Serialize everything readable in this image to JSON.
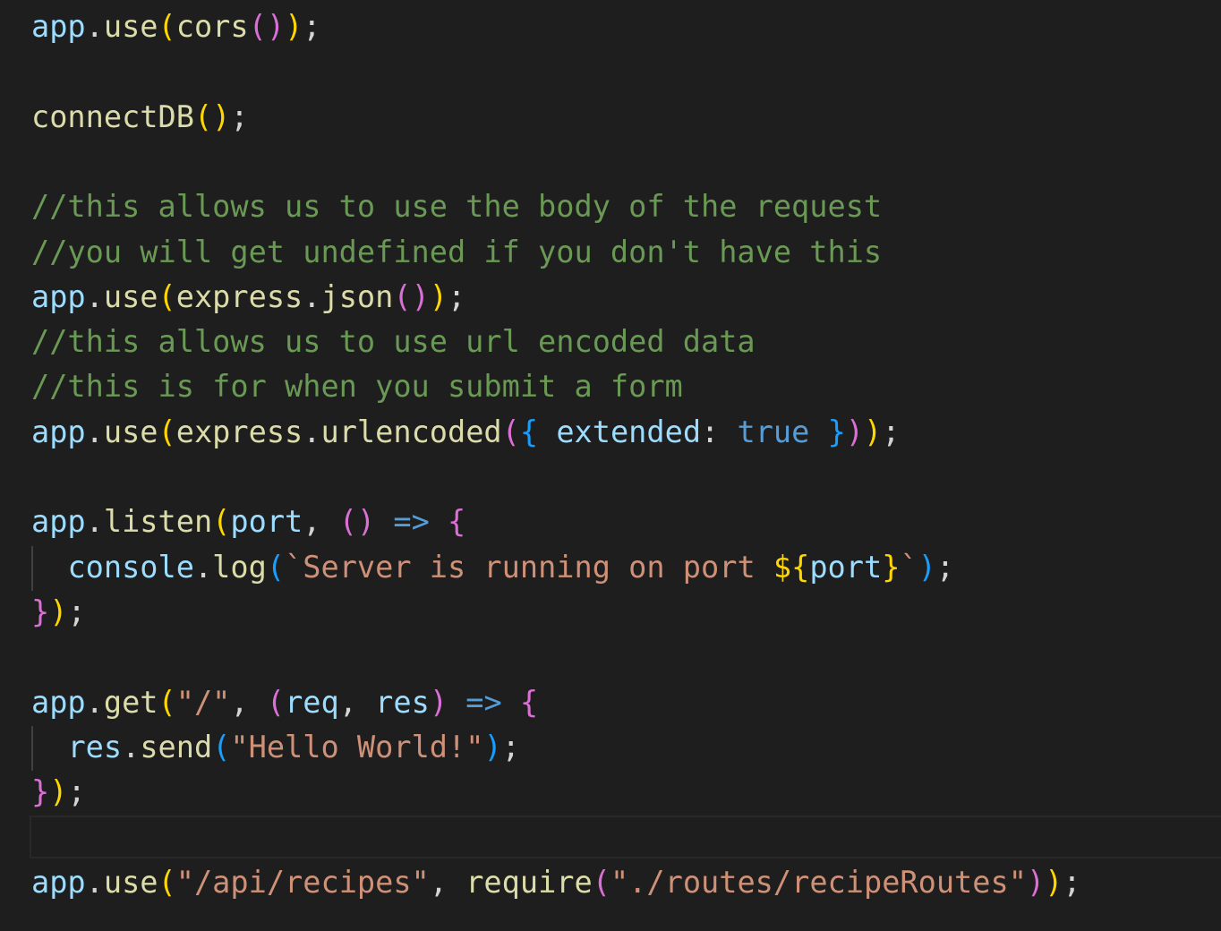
{
  "colors": {
    "background": "#1e1e1e",
    "variable": "#9cdcfe",
    "object": "#4fc1ff",
    "function": "#dcdcaa",
    "string": "#ce9178",
    "comment": "#6a9955",
    "keyword": "#569cd6",
    "bracket_level_1": "#ffd700",
    "bracket_level_2": "#da70d6",
    "bracket_level_3": "#179fff"
  },
  "code_lines": [
    [
      [
        "app",
        "var"
      ],
      [
        ".",
        "punc"
      ],
      [
        "use",
        "fn"
      ],
      [
        "(",
        "b1"
      ],
      [
        "cors",
        "fn"
      ],
      [
        "(",
        "b2"
      ],
      [
        ")",
        "b2"
      ],
      [
        ")",
        "b1"
      ],
      [
        ";",
        "punc"
      ]
    ],
    [],
    [
      [
        "connectDB",
        "fn"
      ],
      [
        "(",
        "b1"
      ],
      [
        ")",
        "b1"
      ],
      [
        ";",
        "punc"
      ]
    ],
    [],
    [
      [
        "//this allows us to use the body of the request",
        "cmt"
      ]
    ],
    [
      [
        "//you will get undefined if you don't have this",
        "cmt"
      ]
    ],
    [
      [
        "app",
        "var"
      ],
      [
        ".",
        "punc"
      ],
      [
        "use",
        "fn"
      ],
      [
        "(",
        "b1"
      ],
      [
        "express",
        "fn"
      ],
      [
        ".",
        "punc"
      ],
      [
        "json",
        "fn"
      ],
      [
        "(",
        "b2"
      ],
      [
        ")",
        "b2"
      ],
      [
        ")",
        "b1"
      ],
      [
        ";",
        "punc"
      ]
    ],
    [
      [
        "//this allows us to use url encoded data",
        "cmt"
      ]
    ],
    [
      [
        "//this is for when you submit a form",
        "cmt"
      ]
    ],
    [
      [
        "app",
        "var"
      ],
      [
        ".",
        "punc"
      ],
      [
        "use",
        "fn"
      ],
      [
        "(",
        "b1"
      ],
      [
        "express",
        "fn"
      ],
      [
        ".",
        "punc"
      ],
      [
        "urlencoded",
        "fn"
      ],
      [
        "(",
        "b2"
      ],
      [
        "{",
        "b3"
      ],
      [
        " ",
        "punc"
      ],
      [
        "extended",
        "var"
      ],
      [
        ": ",
        "punc"
      ],
      [
        "true",
        "kw"
      ],
      [
        " ",
        "punc"
      ],
      [
        "}",
        "b3"
      ],
      [
        ")",
        "b2"
      ],
      [
        ")",
        "b1"
      ],
      [
        ";",
        "punc"
      ]
    ],
    [],
    [
      [
        "app",
        "var"
      ],
      [
        ".",
        "punc"
      ],
      [
        "listen",
        "fn"
      ],
      [
        "(",
        "b1"
      ],
      [
        "port",
        "var"
      ],
      [
        ", ",
        "punc"
      ],
      [
        "(",
        "b2"
      ],
      [
        ")",
        "b2"
      ],
      [
        " ",
        "punc"
      ],
      [
        "=>",
        "kw"
      ],
      [
        " ",
        "punc"
      ],
      [
        "{",
        "b2"
      ]
    ],
    [
      [
        "  ",
        "punc"
      ],
      [
        "console",
        "var"
      ],
      [
        ".",
        "punc"
      ],
      [
        "log",
        "fn"
      ],
      [
        "(",
        "b3"
      ],
      [
        "`Server is running on port ",
        "str"
      ],
      [
        "${",
        "b1"
      ],
      [
        "port",
        "var"
      ],
      [
        "}",
        "b1"
      ],
      [
        "`",
        "str"
      ],
      [
        ")",
        "b3"
      ],
      [
        ";",
        "punc"
      ]
    ],
    [
      [
        "}",
        "b2"
      ],
      [
        ")",
        "b1"
      ],
      [
        ";",
        "punc"
      ]
    ],
    [],
    [
      [
        "app",
        "var"
      ],
      [
        ".",
        "punc"
      ],
      [
        "get",
        "fn"
      ],
      [
        "(",
        "b1"
      ],
      [
        "\"/\"",
        "str"
      ],
      [
        ", ",
        "punc"
      ],
      [
        "(",
        "b2"
      ],
      [
        "req",
        "var"
      ],
      [
        ", ",
        "punc"
      ],
      [
        "res",
        "var"
      ],
      [
        ")",
        "b2"
      ],
      [
        " ",
        "punc"
      ],
      [
        "=>",
        "kw"
      ],
      [
        " ",
        "punc"
      ],
      [
        "{",
        "b2"
      ]
    ],
    [
      [
        "  ",
        "punc"
      ],
      [
        "res",
        "var"
      ],
      [
        ".",
        "punc"
      ],
      [
        "send",
        "fn"
      ],
      [
        "(",
        "b3"
      ],
      [
        "\"Hello World!\"",
        "str"
      ],
      [
        ")",
        "b3"
      ],
      [
        ";",
        "punc"
      ]
    ],
    [
      [
        "}",
        "b2"
      ],
      [
        ")",
        "b1"
      ],
      [
        ";",
        "punc"
      ]
    ],
    [],
    [
      [
        "app",
        "var"
      ],
      [
        ".",
        "punc"
      ],
      [
        "use",
        "fn"
      ],
      [
        "(",
        "b1"
      ],
      [
        "\"/api/recipes\"",
        "str"
      ],
      [
        ", ",
        "punc"
      ],
      [
        "require",
        "fn"
      ],
      [
        "(",
        "b2"
      ],
      [
        "\"./routes/recipeRoutes\"",
        "str"
      ],
      [
        ")",
        "b2"
      ],
      [
        ")",
        "b1"
      ],
      [
        ";",
        "punc"
      ]
    ]
  ]
}
